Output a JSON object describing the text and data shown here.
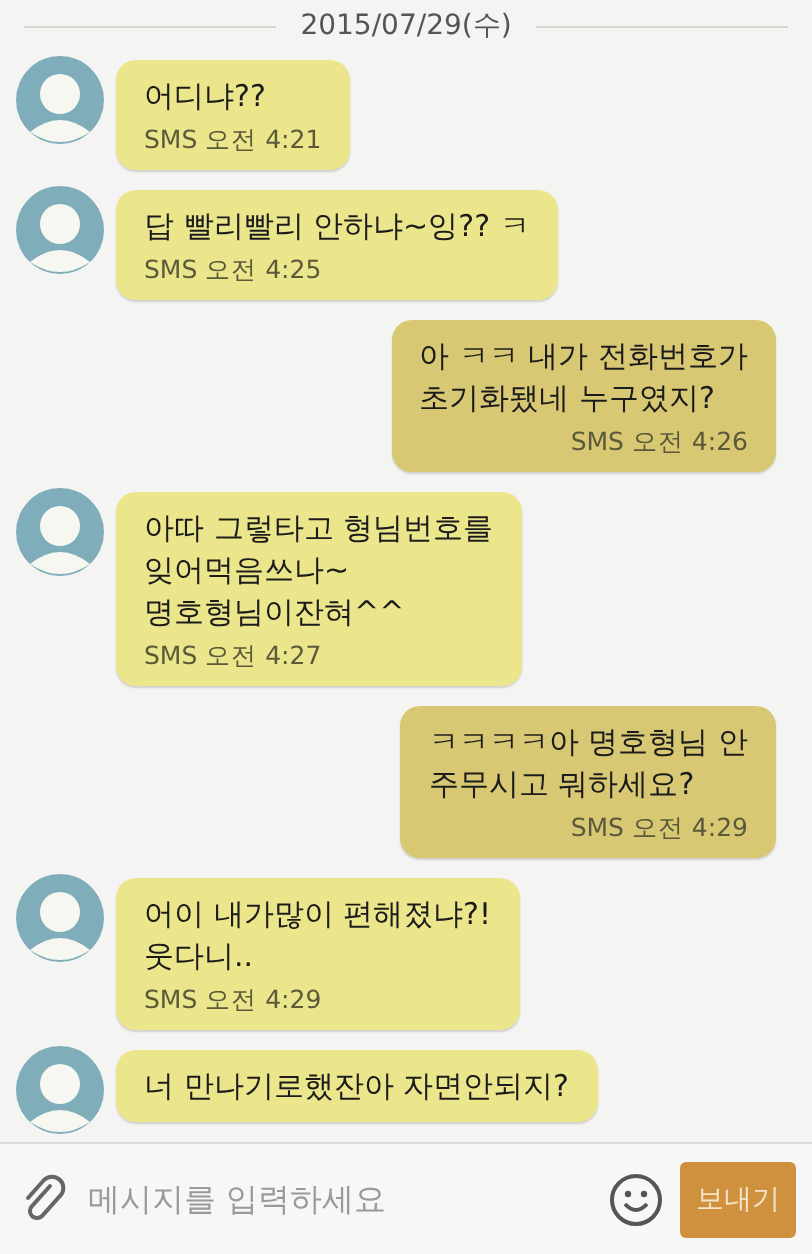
{
  "date_divider": "2015/07/29(수)",
  "messages": [
    {
      "kind": "incoming",
      "text": "어디냐??",
      "time": "SMS 오전 4:21"
    },
    {
      "kind": "incoming",
      "text": "답 빨리빨리 안하냐~잉??  ㅋ",
      "time": "SMS 오전 4:25"
    },
    {
      "kind": "outgoing",
      "text": "아 ㅋㅋ 내가 전화번호가\n초기화됐네 누구였지?",
      "time": "SMS 오전 4:26"
    },
    {
      "kind": "incoming",
      "text": "아따 그렇타고 형님번호를\n잊어먹음쓰나~\n명호형님이잔혀^^",
      "time": "SMS 오전 4:27"
    },
    {
      "kind": "outgoing",
      "text": "ㅋㅋㅋㅋ아 명호형님 안\n주무시고 뭐하세요?",
      "time": "SMS 오전 4:29"
    },
    {
      "kind": "incoming",
      "text": "어이 내가많이 편해졌냐?!\n웃다니..",
      "time": "SMS 오전 4:29"
    },
    {
      "kind": "incoming",
      "text": "너 만나기로했잔아 자면안되지?"
    }
  ],
  "composer": {
    "placeholder": "메시지를 입력하세요",
    "send_button": "보내기"
  }
}
